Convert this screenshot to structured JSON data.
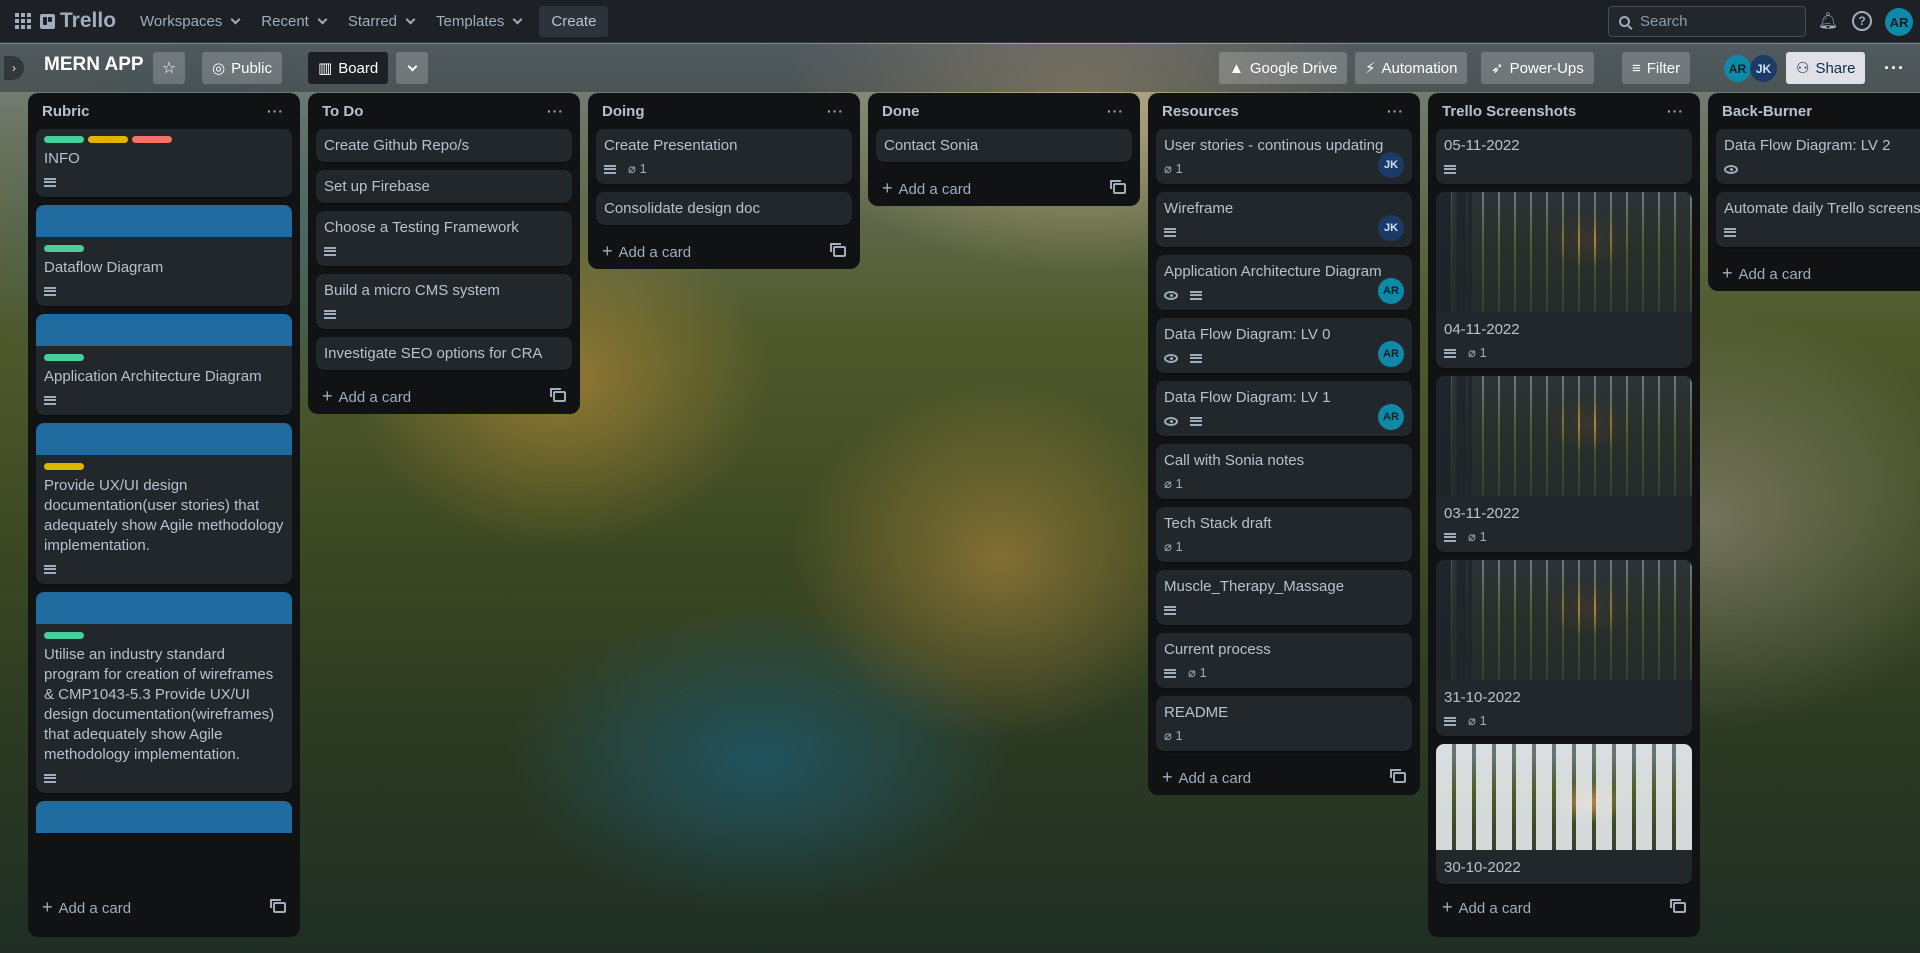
{
  "topbar": {
    "logo": "Trello",
    "nav": [
      "Workspaces",
      "Recent",
      "Starred",
      "Templates"
    ],
    "create": "Create",
    "search_placeholder": "Search",
    "user_initials": "AR"
  },
  "board": {
    "title": "MERN APP",
    "visibility": "Public",
    "view": "Board",
    "powerups": [
      "Google Drive",
      "Automation",
      "Power-Ups"
    ],
    "filter": "Filter",
    "members": [
      "AR",
      "JK"
    ],
    "share": "Share"
  },
  "add_card_label": "Add a card",
  "lists": [
    {
      "title": "Rubric",
      "cards": [
        {
          "title": "INFO",
          "labels": [
            "#4bce97",
            "#e2b203",
            "#f87168"
          ]
        },
        {
          "title": "Dataflow Diagram",
          "labels": [
            "#4bce97"
          ]
        },
        {
          "title": "Application Architecture Diagram",
          "labels": [
            "#4bce97"
          ]
        },
        {
          "title": "Provide UX/UI design documentation(user stories) that adequately show Agile methodology implementation.",
          "labels": [
            "#e2b203"
          ]
        },
        {
          "title": "Utilise an industry standard program for creation of wireframes & CMP1043-5.3 Provide UX/UI design documentation(wireframes) that adequately show Agile methodology implementation.",
          "labels": [
            "#4bce97"
          ]
        }
      ]
    },
    {
      "title": "To Do",
      "cards": [
        {
          "title": "Create Github Repo/s"
        },
        {
          "title": "Set up Firebase"
        },
        {
          "title": "Choose a Testing Framework"
        },
        {
          "title": "Build a micro CMS system"
        },
        {
          "title": "Investigate SEO options for CRA"
        }
      ]
    },
    {
      "title": "Doing",
      "cards": [
        {
          "title": "Create Presentation",
          "attachments": "1"
        },
        {
          "title": "Consolidate design doc"
        }
      ]
    },
    {
      "title": "Done",
      "cards": [
        {
          "title": "Contact Sonia"
        }
      ]
    },
    {
      "title": "Resources",
      "cards": [
        {
          "title": "User stories - continous updating",
          "attachments": "1",
          "member": "JK"
        },
        {
          "title": "Wireframe",
          "member": "JK"
        },
        {
          "title": "Application Architecture Diagram",
          "member": "AR"
        },
        {
          "title": "Data Flow Diagram: LV 0",
          "member": "AR"
        },
        {
          "title": "Data Flow Diagram: LV 1",
          "member": "AR"
        },
        {
          "title": "Call with Sonia notes",
          "attachments": "1"
        },
        {
          "title": "Tech Stack draft",
          "attachments": "1"
        },
        {
          "title": "Muscle_Therapy_Massage"
        },
        {
          "title": "Current process",
          "attachments": "1"
        },
        {
          "title": "README",
          "attachments": "1"
        }
      ]
    },
    {
      "title": "Trello Screenshots",
      "cards": [
        {
          "title": "05-11-2022"
        },
        {
          "title": "04-11-2022",
          "attachments": "1"
        },
        {
          "title": "03-11-2022",
          "attachments": "1"
        },
        {
          "title": "31-10-2022",
          "attachments": "1"
        },
        {
          "title": "30-10-2022"
        }
      ]
    },
    {
      "title": "Back-Burner",
      "cards": [
        {
          "title": "Data Flow Diagram: LV 2"
        },
        {
          "title": "Automate daily Trello screensh"
        }
      ]
    }
  ]
}
